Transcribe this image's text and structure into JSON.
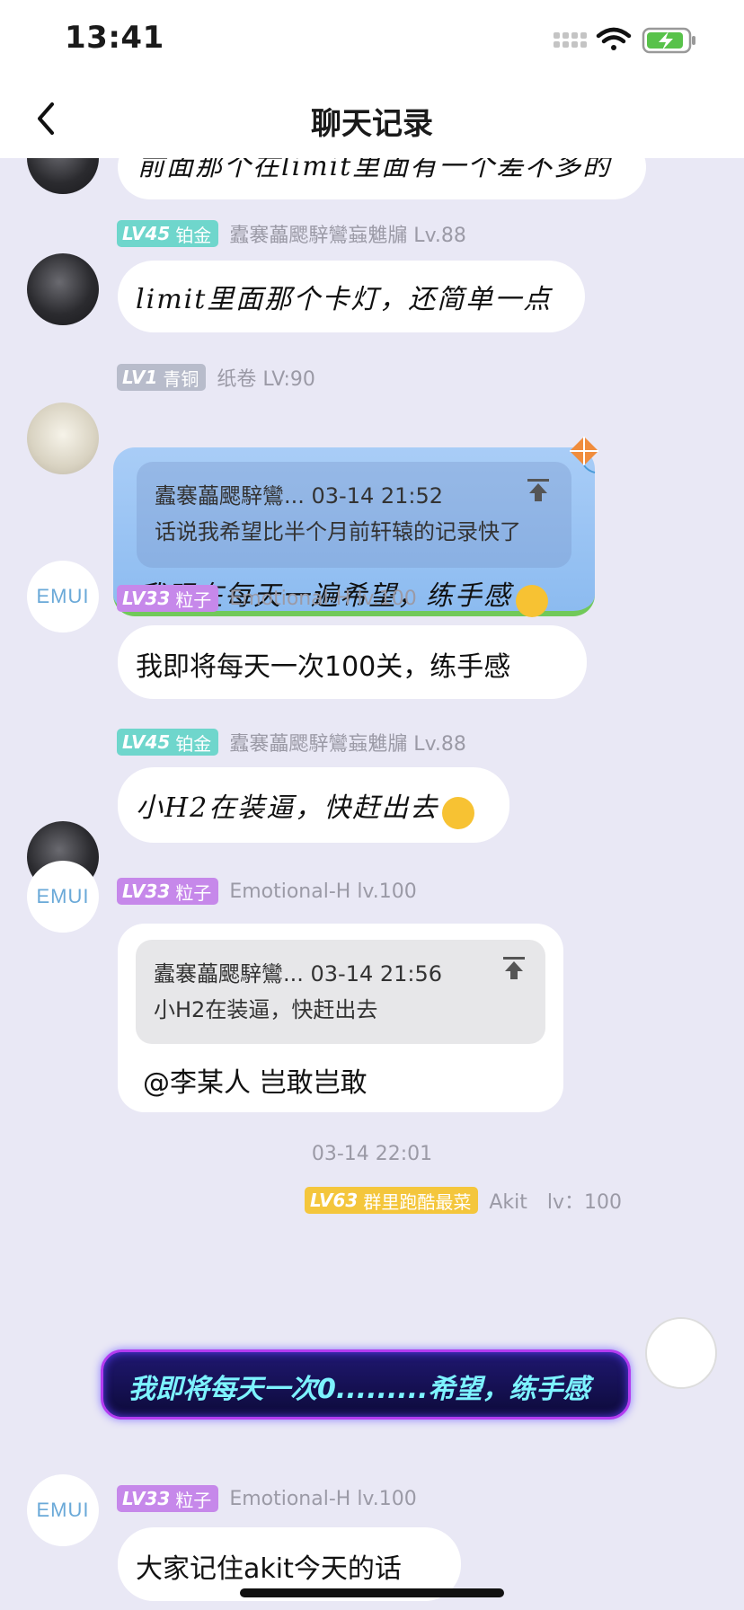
{
  "status_bar": {
    "time": "13:41"
  },
  "nav": {
    "title": "聊天记录"
  },
  "colors": {
    "background": "#e9e8f5",
    "badge_cyan": "#6fd6cc",
    "badge_gray": "#b8bccb",
    "badge_purple": "#c688ea",
    "badge_yellow": "#f4c63c",
    "neon_text": "#7df3ff"
  },
  "messages": [
    {
      "side": "left",
      "text": "前面那个在limit里面有一个差不多的"
    },
    {
      "side": "left",
      "level": "LV45",
      "rank": "铂金",
      "name": "蠹褰藟颸騂鸞蝱魋牖 Lv.88",
      "text": "limit里面那个卡灯，还简单一点"
    },
    {
      "side": "left",
      "level": "LV1",
      "rank": "青铜",
      "name": "纸卷 LV:90",
      "quote": {
        "header": "蠹褰藟颸騂鸞... 03-14 21:52",
        "body": "话说我希望比半个月前轩辕的记录快了"
      },
      "text": "我现在每天一遍希望，练手感"
    },
    {
      "side": "left",
      "level": "LV33",
      "rank": "粒子",
      "name": "Emotional-H lv.100",
      "text": "我即将每天一次100关，练手感"
    },
    {
      "side": "left",
      "level": "LV45",
      "rank": "铂金",
      "name": "蠹褰藟颸騂鸞蝱魋牖 Lv.88",
      "text": "小H2在装逼，快赶出去"
    },
    {
      "side": "left",
      "level": "LV33",
      "rank": "粒子",
      "name": "Emotional-H lv.100",
      "quote": {
        "header": "蠹褰藟颸騂鸞... 03-14 21:56",
        "body": "小H2在装逼，快赶出去"
      },
      "text": "@李某人 岂敢岂敢"
    },
    {
      "timestamp": "03-14 22:01"
    },
    {
      "side": "right",
      "level": "LV63",
      "rank": "群里跑酷最菜",
      "name": "Akit　lv：100",
      "text": "我即将每天一次0.........希望，练手感"
    },
    {
      "side": "left",
      "level": "LV33",
      "rank": "粒子",
      "name": "Emotional-H lv.100",
      "text": "大家记住akit今天的话"
    }
  ],
  "avatar_labels": {
    "emui": "EMUI"
  },
  "icons": [
    "back-chevron-icon",
    "signal-icon",
    "wifi-icon",
    "battery-charging-icon",
    "pin-to-top-icon",
    "kite-icon",
    "laughing-emoji-icon",
    "smug-emoji-icon"
  ]
}
